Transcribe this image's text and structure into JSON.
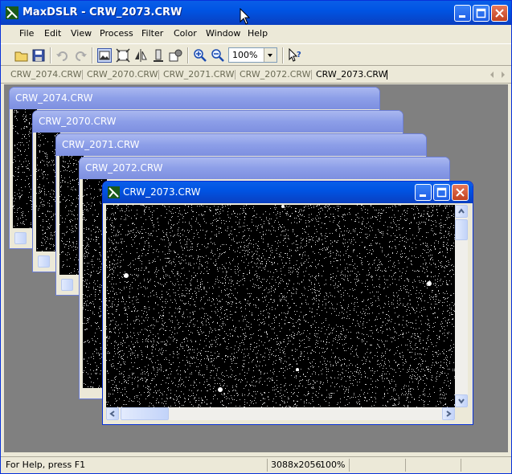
{
  "app": {
    "title": "MaxDSLR - CRW_2073.CRW"
  },
  "menu": [
    {
      "key": "File",
      "label": "File"
    },
    {
      "key": "Edit",
      "label": "Edit"
    },
    {
      "key": "View",
      "label": "View"
    },
    {
      "key": "Process",
      "label": "Process"
    },
    {
      "key": "Filter",
      "label": "Filter"
    },
    {
      "key": "Color",
      "label": "Color"
    },
    {
      "key": "Window",
      "label": "Window"
    },
    {
      "key": "Help",
      "label": "Help"
    }
  ],
  "toolbar": {
    "zoom_value": "100%",
    "icons": [
      "open-icon",
      "save-icon",
      "undo-icon",
      "redo-icon",
      "image-view-icon",
      "fit-icon",
      "flip-icon",
      "stack-icon",
      "settings-icon",
      "zoom-in-icon",
      "zoom-out-icon",
      "context-help-icon"
    ]
  },
  "tabs": [
    {
      "label": "CRW_2074.CRW",
      "active": false
    },
    {
      "label": "CRW_2070.CRW",
      "active": false
    },
    {
      "label": "CRW_2071.CRW",
      "active": false
    },
    {
      "label": "CRW_2072.CRW",
      "active": false
    },
    {
      "label": "CRW_2073.CRW",
      "active": true
    }
  ],
  "child_windows": [
    {
      "title": "CRW_2074.CRW"
    },
    {
      "title": "CRW_2070.CRW"
    },
    {
      "title": "CRW_2071.CRW"
    },
    {
      "title": "CRW_2072.CRW"
    },
    {
      "title": "CRW_2073.CRW",
      "active": true
    }
  ],
  "status": {
    "help": "For Help, press F1",
    "dimensions": "3088x2056",
    "zoom": "100%"
  },
  "colors": {
    "title_active": "#0054e3",
    "title_inactive": "#8c9ee8",
    "mdi_background": "#808080"
  }
}
